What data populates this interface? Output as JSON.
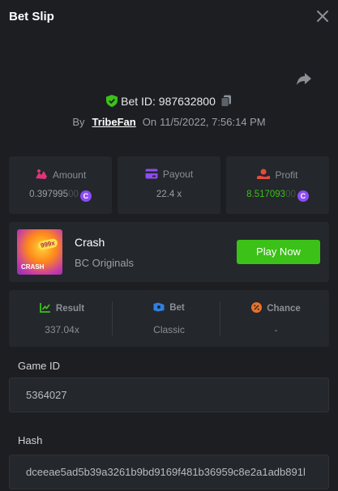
{
  "header": {
    "title": "Bet Slip"
  },
  "bet": {
    "id_label": "Bet ID: 987632800",
    "by_label": "By",
    "username": "TribeFan",
    "on_label": "On",
    "timestamp": "11/5/2022, 7:56:14 PM"
  },
  "stats": {
    "amount": {
      "label": "Amount",
      "value_main": "0.397995",
      "value_dim": "00",
      "coin": "C"
    },
    "payout": {
      "label": "Payout",
      "value": "22.4 x"
    },
    "profit": {
      "label": "Profit",
      "value_main": "8.517093",
      "value_dim": "00",
      "coin": "C"
    }
  },
  "game": {
    "name": "Crash",
    "provider": "BC Originals",
    "play_label": "Play Now",
    "thumb_badge": "999x",
    "thumb_text": "CRASH"
  },
  "result": {
    "result": {
      "label": "Result",
      "value": "337.04x"
    },
    "bet": {
      "label": "Bet",
      "value": "Classic"
    },
    "chance": {
      "label": "Chance",
      "value": "-"
    }
  },
  "fields": {
    "game_id": {
      "label": "Game ID",
      "value": "5364027"
    },
    "hash": {
      "label": "Hash",
      "value": "dceeae5ad5b39a3261b9bd9169f481b36959c8e2a1adb891l"
    }
  },
  "colors": {
    "accent_green": "#3bc117",
    "coin": "#8c4cf5",
    "profit": "#3bc117",
    "amount_icon": "#e0357a",
    "payout_icon": "#8c4cf5",
    "profit_icon": "#e84a3c"
  },
  "icons": [
    "close-icon",
    "share-icon",
    "shield-icon",
    "copy-icon",
    "amount-icon",
    "payout-icon",
    "profit-icon",
    "coin-icon",
    "result-icon",
    "bet-icon",
    "chance-icon"
  ]
}
